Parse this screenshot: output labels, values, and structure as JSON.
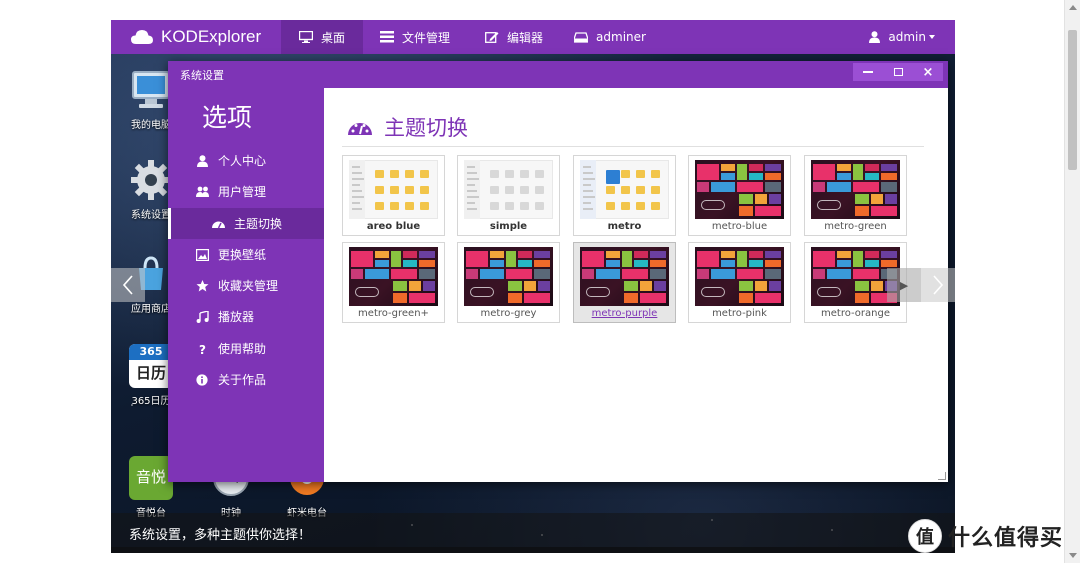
{
  "app": {
    "brand": "KODExplorer",
    "nav": [
      {
        "label": "桌面",
        "icon": "monitor-icon",
        "active": true
      },
      {
        "label": "文件管理",
        "icon": "list-icon",
        "active": false
      },
      {
        "label": "编辑器",
        "icon": "edit-icon",
        "active": false
      },
      {
        "label": "adminer",
        "icon": "drive-icon",
        "active": false
      }
    ],
    "user": "admin"
  },
  "desktop": {
    "icons": [
      {
        "label": "我的电脑",
        "icon": "computer-icon"
      },
      {
        "label": "系统设置",
        "icon": "gear-icon"
      },
      {
        "label": "应用商店",
        "icon": "store-icon"
      },
      {
        "label": "365日历",
        "icon": "calendar-icon"
      },
      {
        "label": "音悦台",
        "icon": "music-video-icon"
      },
      {
        "label": "时钟",
        "icon": "clock-icon"
      },
      {
        "label": "虾米电台",
        "icon": "radio-icon"
      }
    ],
    "calendar_badge": "365",
    "calendar_text": "日历",
    "yinyue_text": "音悦"
  },
  "dialog": {
    "title": "系统设置",
    "sidebar_title": "选项",
    "menu": [
      {
        "label": "个人中心",
        "icon": "user-icon"
      },
      {
        "label": "用户管理",
        "icon": "users-icon"
      },
      {
        "label": "主题切换",
        "icon": "dashboard-icon",
        "active": true
      },
      {
        "label": "更换壁纸",
        "icon": "image-icon"
      },
      {
        "label": "收藏夹管理",
        "icon": "star-icon"
      },
      {
        "label": "播放器",
        "icon": "music-icon"
      },
      {
        "label": "使用帮助",
        "icon": "help-icon"
      },
      {
        "label": "关于作品",
        "icon": "info-icon"
      }
    ],
    "content_title": "主题切换",
    "themes": [
      {
        "name": "areo blue",
        "style": "light"
      },
      {
        "name": "simple",
        "style": "simple"
      },
      {
        "name": "metro",
        "style": "metro-light"
      },
      {
        "name": "metro-blue",
        "style": "metro"
      },
      {
        "name": "metro-green",
        "style": "metro"
      },
      {
        "name": "metro-green+",
        "style": "metro"
      },
      {
        "name": "metro-grey",
        "style": "metro"
      },
      {
        "name": "metro-purple",
        "style": "metro",
        "selected": true
      },
      {
        "name": "metro-pink",
        "style": "metro"
      },
      {
        "name": "metro-orange",
        "style": "metro"
      }
    ]
  },
  "caption": "系统设置，多种主题供你选择！",
  "watermark": {
    "logo_text": "值",
    "text": "什么值得买"
  },
  "colors": {
    "accent": "#7e34b6",
    "accent_dark": "#6a2a9c"
  }
}
